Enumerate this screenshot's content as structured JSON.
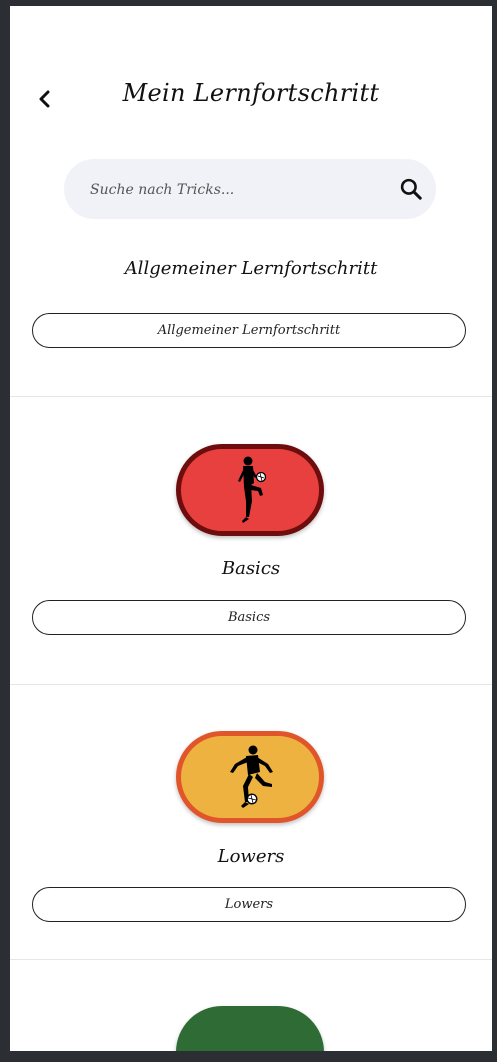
{
  "header": {
    "title": "Mein Lernfortschritt",
    "back_icon": "chevron-left-icon"
  },
  "search": {
    "placeholder": "Suche nach Tricks...",
    "value": "",
    "icon": "search-icon"
  },
  "overall": {
    "heading": "Allgemeiner Lernfortschritt",
    "bar_label": "Allgemeiner Lernfortschritt"
  },
  "categories": [
    {
      "name": "Basics",
      "bar_label": "Basics",
      "icon": "juggling-player-icon",
      "fill_color": "#e8403f",
      "border_color": "#6e0d0d"
    },
    {
      "name": "Lowers",
      "bar_label": "Lowers",
      "icon": "lower-trick-player-icon",
      "fill_color": "#edb23f",
      "border_color": "#e0562a"
    },
    {
      "name": "",
      "fill_color": "#2f6b35"
    }
  ]
}
